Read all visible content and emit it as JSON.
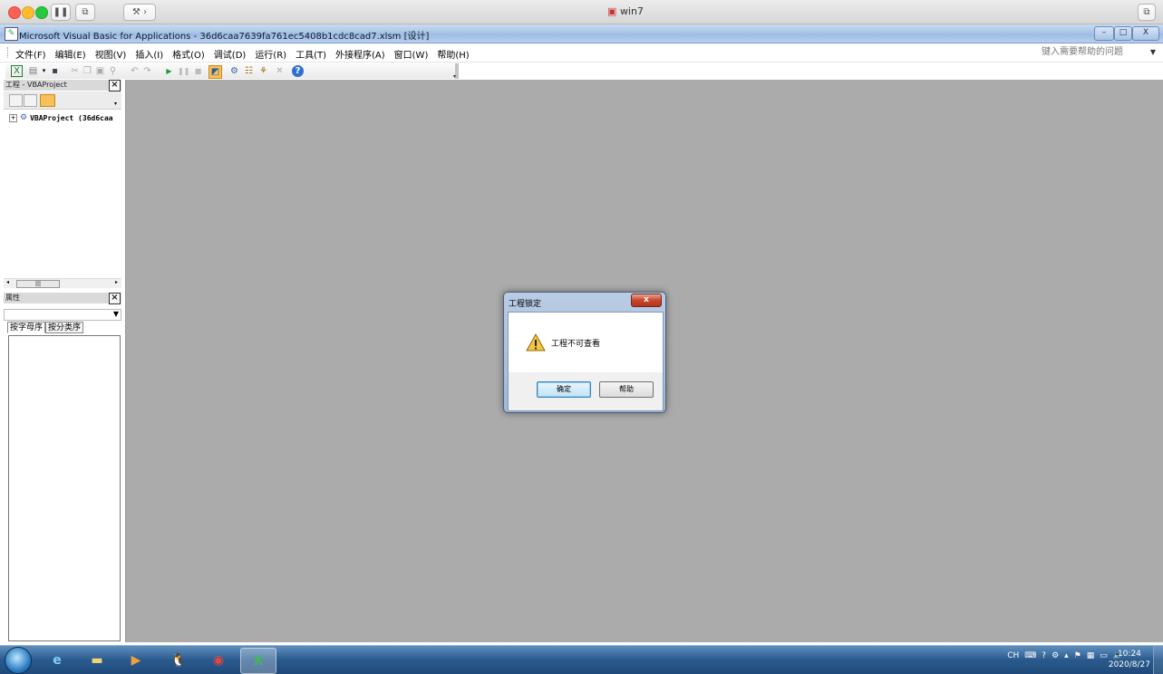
{
  "host": {
    "title": "win7"
  },
  "vba_window": {
    "title": "Microsoft Visual Basic for Applications - 36d6caa7639fa761ec5408b1cdc8cad7.xlsm [设计]",
    "controls": {
      "minimize": "–",
      "restore": "□",
      "close": "X"
    }
  },
  "menu": {
    "items": [
      "文件(F)",
      "编辑(E)",
      "视图(V)",
      "插入(I)",
      "格式(O)",
      "调试(D)",
      "运行(R)",
      "工具(T)",
      "外接程序(A)",
      "窗口(W)",
      "帮助(H)"
    ],
    "help_placeholder": "键入需要帮助的问题"
  },
  "project_pane": {
    "title": "工程 - VBAProject",
    "tree_item": "VBAProject (36d6caa"
  },
  "properties_pane": {
    "title": "属性",
    "tabs": [
      "按字母序",
      "按分类序"
    ]
  },
  "dialog": {
    "title": "工程锁定",
    "message": "工程不可查看",
    "ok_label": "确定",
    "help_label": "帮助",
    "close_label": "x"
  },
  "tray": {
    "lang": "CH",
    "time": "10:24",
    "date": "2020/8/27"
  },
  "colors": {
    "mdi_background": "#ababab",
    "title_gradient": "#a9c5e8",
    "taskbar": "#2a5a8d"
  }
}
